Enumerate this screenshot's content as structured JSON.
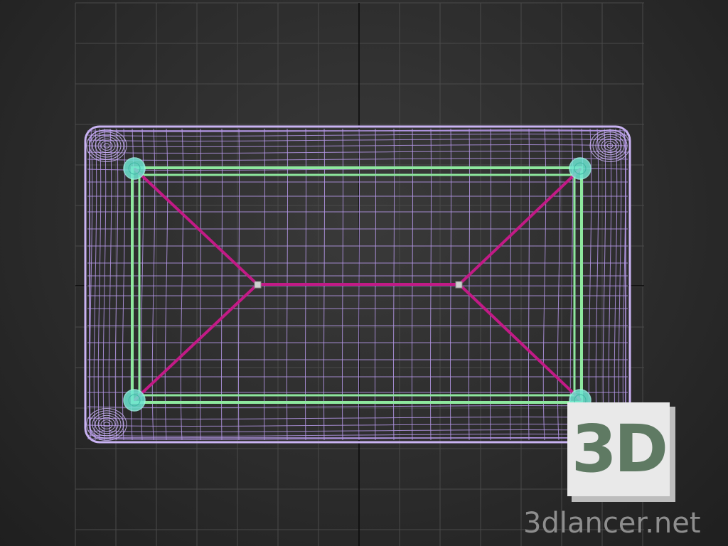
{
  "viewport": {
    "view": "top",
    "background": "#2c2c2c",
    "grid_color": "#4a4a4a",
    "axis_color": "#0a0a0a"
  },
  "scene": {
    "mesh_wire_color": "#b598e8",
    "mesh_wire_bright": "#c9b3f2",
    "frame_color": "#8ee89e",
    "brace_color": "#c21a86",
    "leg_color": "#6fe6d2"
  },
  "watermark": {
    "badge_text": "3D",
    "badge_text_color": "#5f7a63",
    "site": "3dlancer.net"
  }
}
